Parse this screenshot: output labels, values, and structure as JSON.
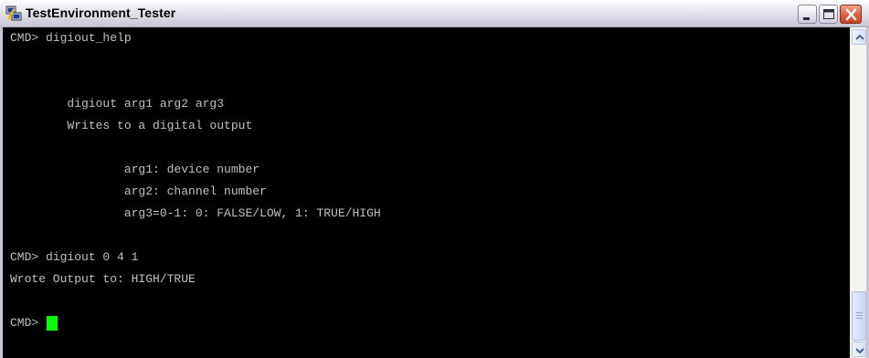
{
  "window": {
    "title": "TestEnvironment_Tester",
    "icon": "putty-terminal-icon"
  },
  "console": {
    "lines": [
      "CMD> digiout_help",
      "",
      "",
      "        digiout arg1 arg2 arg3",
      "        Writes to a digital output",
      "",
      "                arg1: device number",
      "                arg2: channel number",
      "                arg3=0-1: 0: FALSE/LOW, 1: TRUE/HIGH",
      "",
      "CMD> digiout 0 4 1",
      "Wrote Output to: HIGH/TRUE",
      "",
      "CMD> "
    ],
    "text_color": "#c0c0c0",
    "background": "#000000",
    "cursor_color": "#00ff00"
  }
}
